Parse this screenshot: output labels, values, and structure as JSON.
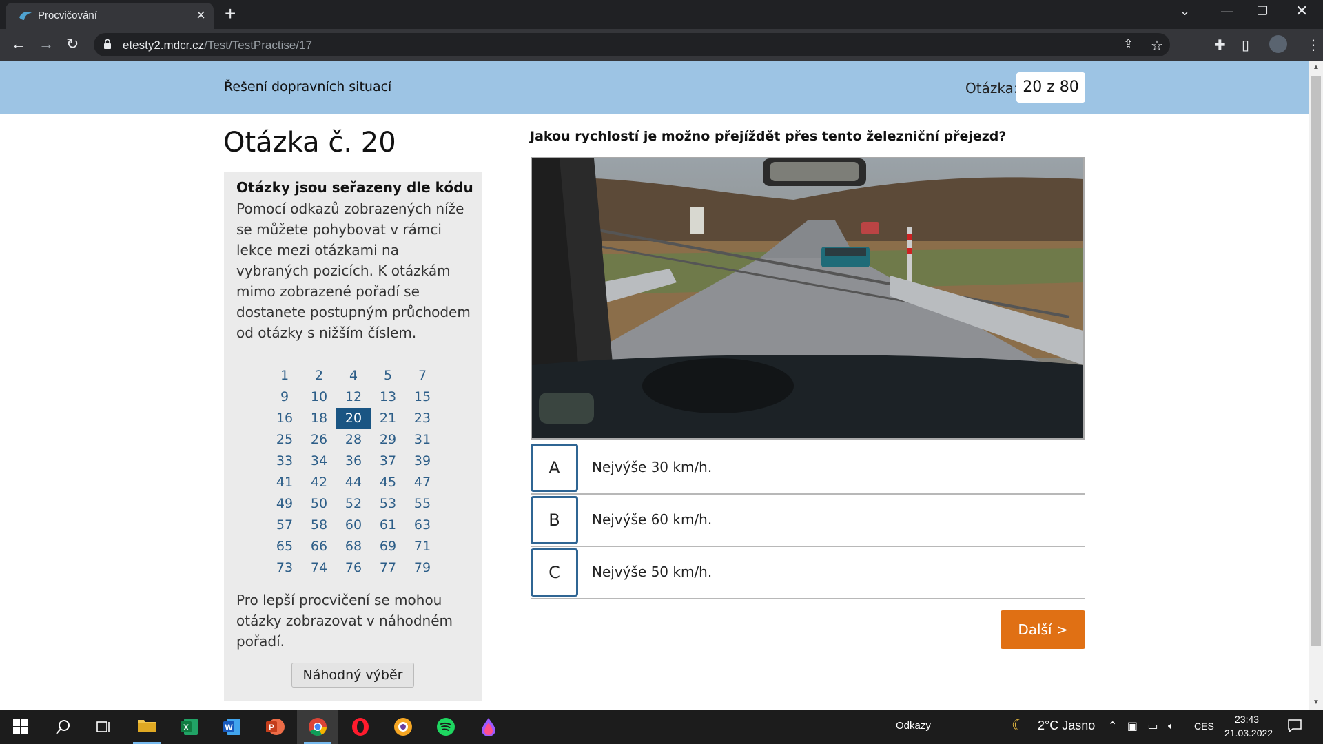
{
  "browser": {
    "tab_title": "Procvičování",
    "url_host": "etesty2.mdcr.cz",
    "url_path": "/Test/TestPractise/17"
  },
  "header": {
    "section_title": "Řešení dopravních situací",
    "counter_label": "Otázka:",
    "counter_value": "20 z 80"
  },
  "question_heading": "Otázka č. 20",
  "sidebar": {
    "title": "Otázky jsou seřazeny dle kódu",
    "description": "Pomocí odkazů zobrazených níže se můžete pohybovat v rámci lekce mezi otázkami na vybraných pozicích. K otázkám mimo zobrazené pořadí se dostanete postupným průchodem od otázky s nižším číslem.",
    "question_numbers": [
      "1",
      "2",
      "4",
      "5",
      "7",
      "9",
      "10",
      "12",
      "13",
      "15",
      "16",
      "18",
      "20",
      "21",
      "23",
      "25",
      "26",
      "28",
      "29",
      "31",
      "33",
      "34",
      "36",
      "37",
      "39",
      "41",
      "42",
      "44",
      "45",
      "47",
      "49",
      "50",
      "52",
      "53",
      "55",
      "57",
      "58",
      "60",
      "61",
      "63",
      "65",
      "66",
      "68",
      "69",
      "71",
      "73",
      "74",
      "76",
      "77",
      "79"
    ],
    "active_number": "20",
    "note": "Pro lepší procvičení se mohou otázky zobrazovat v náhodném pořadí.",
    "random_button": "Náhodný výběr"
  },
  "question_text": "Jakou rychlostí je možno přejíždět přes tento železniční přejezd?",
  "answers": [
    {
      "letter": "A",
      "text": "Nejvýše 30 km/h."
    },
    {
      "letter": "B",
      "text": "Nejvýše 60 km/h."
    },
    {
      "letter": "C",
      "text": "Nejvýše 50 km/h."
    }
  ],
  "next_button": "Další >",
  "taskbar": {
    "links_label": "Odkazy",
    "weather": "2°C  Jasno",
    "language": "CES",
    "time": "23:43",
    "date": "21.03.2022"
  },
  "colors": {
    "header_strip": "#9dc4e4",
    "accent_blue": "#1a5583",
    "next_button": "#e07014"
  }
}
